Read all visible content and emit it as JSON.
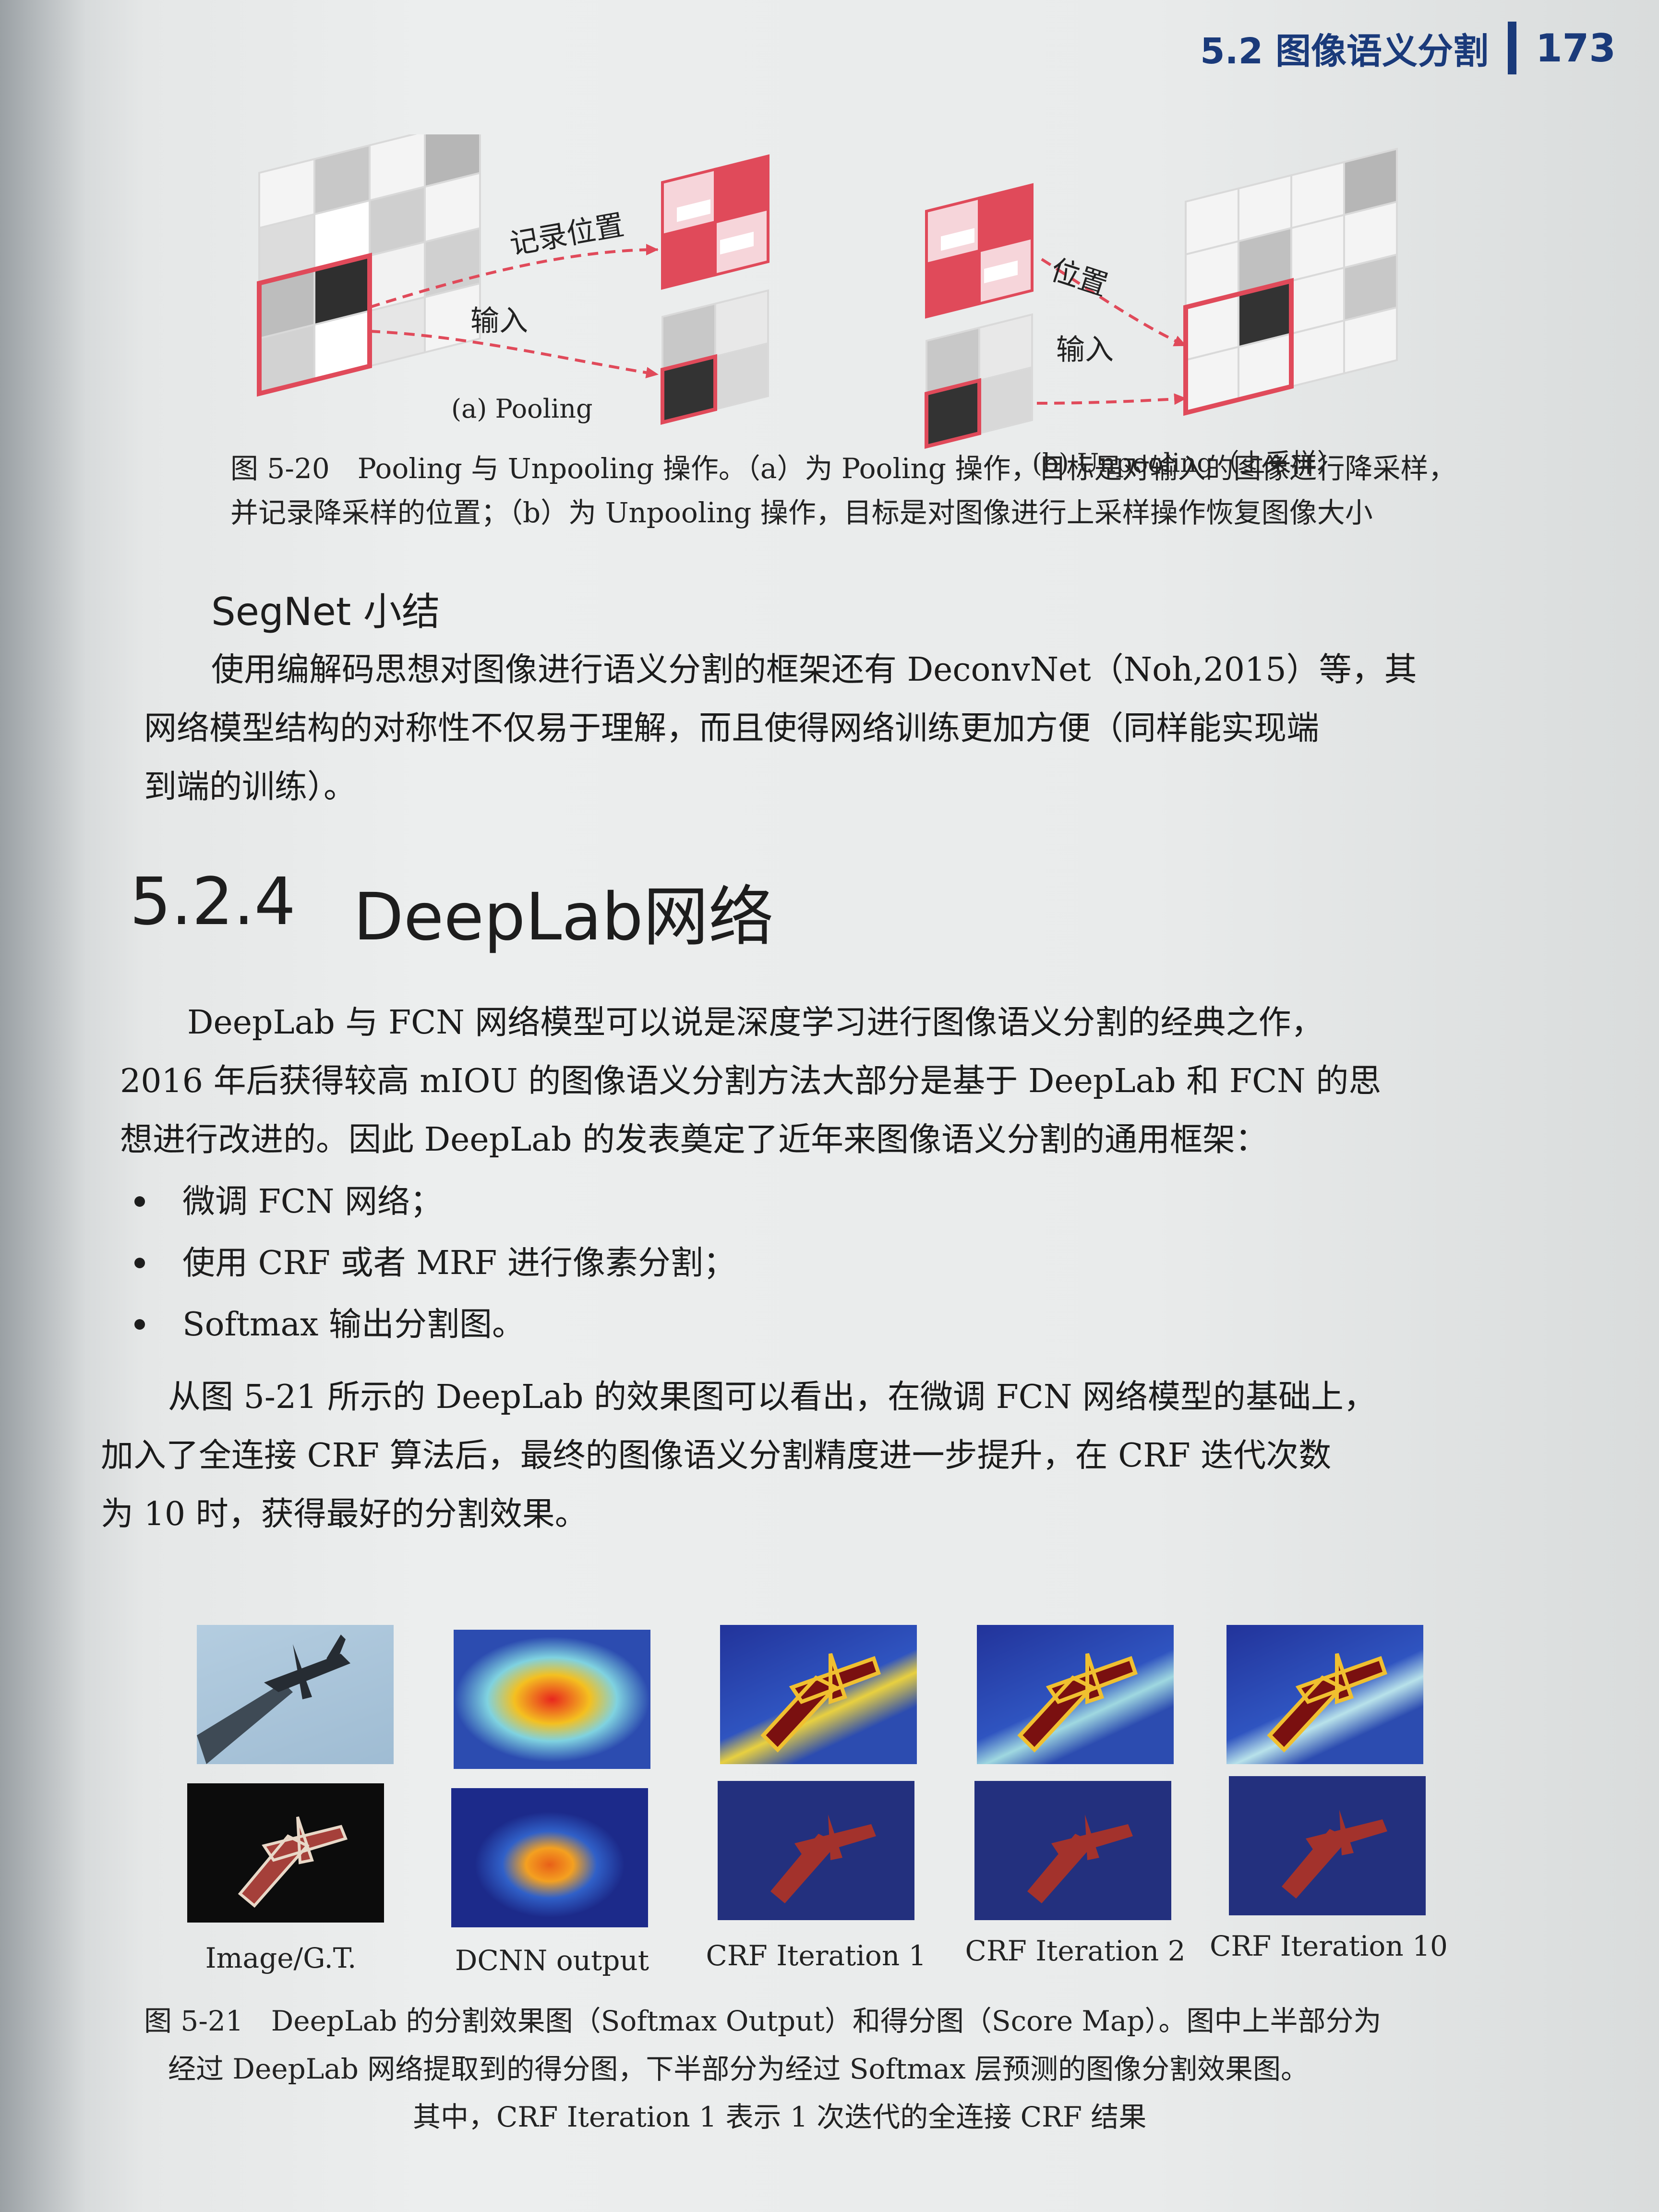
{
  "header": {
    "section": "5.2 图像语义分割",
    "page_number": "173"
  },
  "figure_5_20": {
    "label_record_position": "记录位置",
    "label_input_a": "输入",
    "label_position": "位置",
    "label_input_b": "输入",
    "sub_a": "(a) Pooling",
    "sub_b": "(b) Unpooling（上采样）",
    "caption_line1": "图 5-20　Pooling 与 Unpooling 操作。（a）为 Pooling 操作，目标是对输入的图像进行降采样，",
    "caption_line2": "并记录降采样的位置；（b）为 Unpooling 操作，目标是对图像进行上采样操作恢复图像大小"
  },
  "segnet": {
    "heading": "SegNet 小结",
    "line1": "使用编解码思想对图像进行语义分割的框架还有 DeconvNet（Noh,2015）等，其",
    "line2": "网络模型结构的对称性不仅易于理解，而且使得网络训练更加方便（同样能实现端",
    "line3": "到端的训练）。"
  },
  "section": {
    "number": "5.2.4",
    "title": "DeepLab网络"
  },
  "para1": {
    "line1": "DeepLab 与 FCN 网络模型可以说是深度学习进行图像语义分割的经典之作，",
    "line2": "2016 年后获得较高 mIOU 的图像语义分割方法大部分是基于 DeepLab 和 FCN 的思",
    "line3": "想进行改进的。因此 DeepLab 的发表奠定了近年来图像语义分割的通用框架："
  },
  "bullets": [
    "微调 FCN 网络；",
    "使用 CRF 或者 MRF 进行像素分割；",
    "Softmax 输出分割图。"
  ],
  "para2": {
    "line1": "从图 5-21 所示的 DeepLab 的效果图可以看出，在微调 FCN 网络模型的基础上，",
    "line2": "加入了全连接 CRF 算法后，最终的图像语义分割精度进一步提升，在 CRF 迭代次数",
    "line3": "为 10 时，获得最好的分割效果。"
  },
  "figure_5_21": {
    "columns": [
      "Image/G.T.",
      "DCNN output",
      "CRF Iteration 1",
      "CRF Iteration 2",
      "CRF Iteration 10"
    ],
    "caption_line1": "图 5-21　DeepLab 的分割效果图（Softmax Output）和得分图（Score Map）。图中上半部分为",
    "caption_line2": "经过 DeepLab 网络提取到的得分图，下半部分为经过 Softmax 层预测的图像分割效果图。",
    "caption_line3": "其中，CRF Iteration 1 表示 1 次迭代的全连接 CRF 结果"
  },
  "colors": {
    "heading_blue": "#1a3a7a",
    "highlight_red": "#e04a5a",
    "text": "#1d1d1d"
  }
}
